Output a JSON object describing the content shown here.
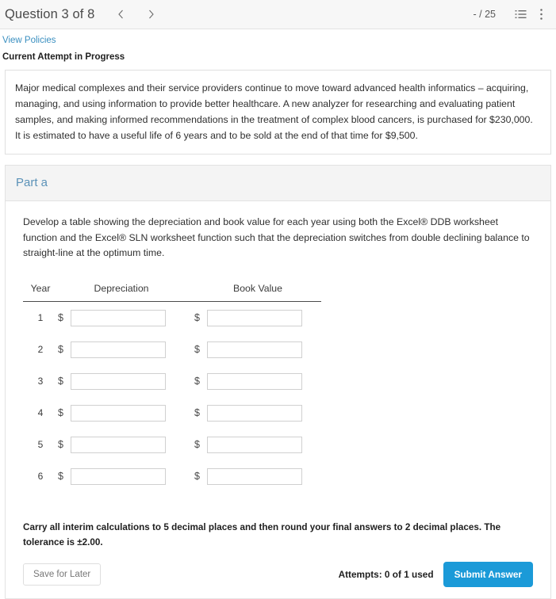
{
  "header": {
    "question_label": "Question 3 of 8",
    "prev_icon": "chevron-left-icon",
    "next_icon": "chevron-right-icon",
    "score": "- / 25",
    "list_icon": "list-icon",
    "menu_icon": "kebab-menu-icon"
  },
  "meta": {
    "policies_link": "View Policies",
    "attempt_status": "Current Attempt in Progress"
  },
  "question": {
    "text": "Major medical complexes and their service providers continue to move toward advanced health informatics – acquiring, managing, and using information to provide better healthcare. A new analyzer for researching and evaluating patient samples, and making informed recommendations in the treatment of complex blood cancers, is purchased for $230,000. It is estimated to have a useful life of 6 years and to be sold at the end of that time for $9,500."
  },
  "part": {
    "title": "Part a",
    "instructions": "Develop a table showing the depreciation and book value for each year using both the Excel® DDB worksheet function and the Excel® SLN worksheet function such that the depreciation switches from double declining balance to straight-line at the optimum time.",
    "table": {
      "headers": [
        "Year",
        "Depreciation",
        "Book Value"
      ],
      "currency_symbol": "$",
      "rows": [
        {
          "year": "1",
          "depreciation": "",
          "book_value": ""
        },
        {
          "year": "2",
          "depreciation": "",
          "book_value": ""
        },
        {
          "year": "3",
          "depreciation": "",
          "book_value": ""
        },
        {
          "year": "4",
          "depreciation": "",
          "book_value": ""
        },
        {
          "year": "5",
          "depreciation": "",
          "book_value": ""
        },
        {
          "year": "6",
          "depreciation": "",
          "book_value": ""
        }
      ]
    },
    "tolerance_note": "Carry all interim calculations to 5 decimal places and then round your final answers to 2 decimal places. The tolerance is ±2.00."
  },
  "footer": {
    "save_label": "Save for Later",
    "attempts": "Attempts: 0 of 1 used",
    "submit_label": "Submit Answer"
  },
  "colors": {
    "accent_blue": "#1b9ad8",
    "link_blue": "#3a8fc0",
    "part_title_blue": "#5b92b8",
    "bar_bg": "#f7f7f7",
    "part_head_bg": "#f4f4f4"
  }
}
